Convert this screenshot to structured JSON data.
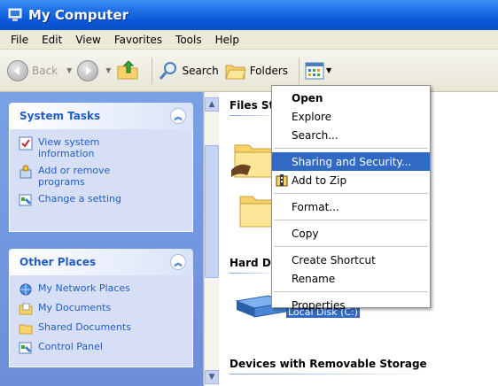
{
  "window": {
    "title": "My Computer"
  },
  "menu": [
    "File",
    "Edit",
    "View",
    "Favorites",
    "Tools",
    "Help"
  ],
  "toolbar": {
    "back": "Back",
    "search": "Search",
    "folders": "Folders"
  },
  "system_tasks": {
    "title": "System Tasks",
    "items": [
      "View system information",
      "Add or remove programs",
      "Change a setting"
    ]
  },
  "other_places": {
    "title": "Other Places",
    "items": [
      "My Network Places",
      "My Documents",
      "Shared Documents",
      "Control Panel"
    ]
  },
  "content": {
    "files_header": "Files Stored on This Computer",
    "files_header_visible": "Files St",
    "hdd_header_visible": "Hard Di",
    "disk_label": "Local Disk (C:)",
    "removable_header": "Devices with Removable Storage"
  },
  "context_menu": {
    "open": "Open",
    "explore": "Explore",
    "search": "Search...",
    "sharing": "Sharing and Security...",
    "zip": "Add to Zip",
    "format": "Format...",
    "copy": "Copy",
    "shortcut": "Create Shortcut",
    "rename": "Rename",
    "properties": "Properties"
  },
  "colors": {
    "accent": "#316ac5",
    "titlebar": "#0a57d8",
    "taskpane": "#6d8ed8"
  }
}
